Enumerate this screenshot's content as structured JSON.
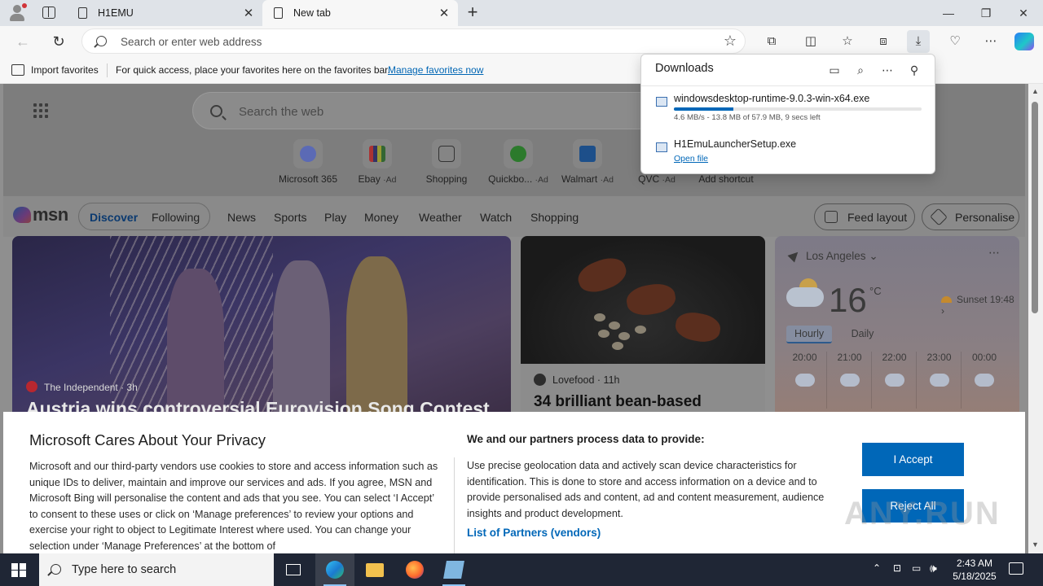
{
  "browser": {
    "tabs": [
      {
        "title": "H1EMU"
      },
      {
        "title": "New tab"
      }
    ],
    "address": {
      "placeholder": "Search or enter web address"
    },
    "favorites_bar": {
      "import_label": "Import favorites",
      "message": "For quick access, place your favorites here on the favorites bar.",
      "manage_link": "Manage favorites now"
    }
  },
  "downloads": {
    "title": "Downloads",
    "items": [
      {
        "filename": "windowsdesktop-runtime-9.0.3-win-x64.exe",
        "status": "4.6 MB/s - 13.8 MB of 57.9 MB, 9 secs left",
        "progress_percent": 24
      },
      {
        "filename": "H1EmuLauncherSetup.exe",
        "action": "Open file"
      }
    ]
  },
  "newtab": {
    "search_placeholder": "Search the web",
    "shortcuts": [
      {
        "label": "Microsoft 365",
        "ad": ""
      },
      {
        "label": "Ebay",
        "ad": "·Ad"
      },
      {
        "label": "Shopping",
        "ad": ""
      },
      {
        "label": "Quickbo...",
        "ad": "·Ad"
      },
      {
        "label": "Walmart",
        "ad": "·Ad"
      },
      {
        "label": "QVC",
        "ad": "·Ad"
      },
      {
        "label": "Add shortcut",
        "ad": ""
      }
    ]
  },
  "msn": {
    "logo": "msn",
    "pill_tabs": [
      "Discover",
      "Following"
    ],
    "nav": [
      "News",
      "Sports",
      "Play",
      "Money",
      "Weather",
      "Watch",
      "Shopping"
    ],
    "feed_layout": "Feed layout",
    "personalise": "Personalise",
    "cards": [
      {
        "source": "The Independent",
        "age": "3h",
        "headline": "Austria wins controversial Eurovision Song Contest"
      },
      {
        "source": "Lovefood",
        "age": "11h",
        "headline": "34 brilliant bean-based"
      }
    ],
    "weather": {
      "location": "Los Angeles",
      "temperature": "16",
      "unit": "°C",
      "sunset": "Sunset 19:48",
      "tabs": [
        "Hourly",
        "Daily"
      ],
      "hours": [
        "20:00",
        "21:00",
        "22:00",
        "23:00",
        "00:00"
      ]
    }
  },
  "privacy": {
    "title": "Microsoft Cares About Your Privacy",
    "body": "Microsoft and our third-party vendors use cookies to store and access information such as unique IDs to deliver, maintain and improve our services and ads. If you agree, MSN and Microsoft Bing will personalise the content and ads that you see. You can select ‘I Accept’ to consent to these uses or click on ‘Manage preferences’ to review your options and exercise your right to object to Legitimate Interest where used.  You can change your selection under ‘Manage Preferences’ at the bottom of",
    "partners_title": "We and our partners process data to provide:",
    "partners_body": "Use precise geolocation data and actively scan device characteristics for identification. This is done to store and access information on a device and to provide personalised ads and content, ad and content measurement, audience insights and product development.",
    "partners_link": "List of Partners (vendors)",
    "accept": "I Accept",
    "reject": "Reject All"
  },
  "watermark": "ANY.RUN",
  "taskbar": {
    "search_placeholder": "Type here to search",
    "time": "2:43 AM",
    "date": "5/18/2025"
  },
  "colors": {
    "accent": "#0067b8",
    "taskbar": "#1f2635"
  }
}
